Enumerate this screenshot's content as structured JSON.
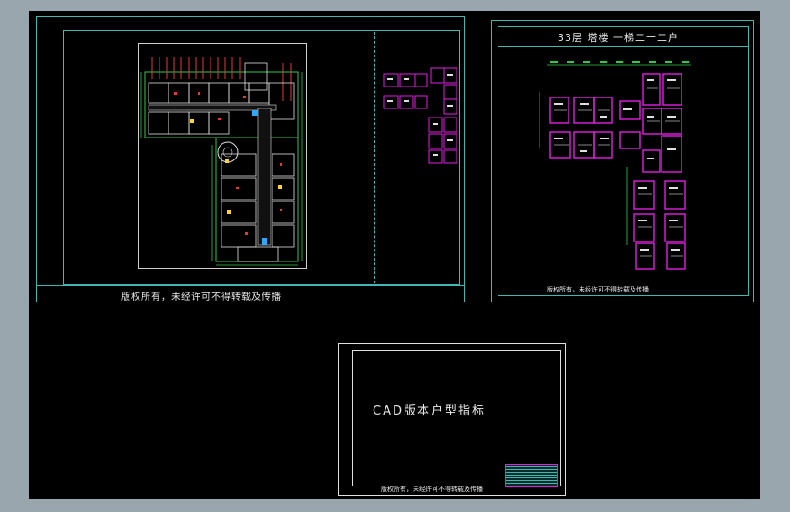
{
  "colors": {
    "background": "#9aa6ae",
    "canvas": "#000000",
    "frame": "#3fb7b2",
    "plan_magenta": "#e020e0",
    "plan_green": "#2ec84a",
    "plan_red": "#e03a3a",
    "plan_white": "#e0e0e0",
    "title_text": "#e8e8e8"
  },
  "sheet1": {
    "footer_text": "版权所有，未经许可不得转载及传播"
  },
  "sheet2": {
    "title": "33层  塔楼  一梯二十二户",
    "footer_text": "版权所有，未经许可不得转载及传播"
  },
  "sheet3": {
    "heading": "CAD版本户型指标",
    "footer_text": "版权所有，未经许可不得转载及传播"
  }
}
